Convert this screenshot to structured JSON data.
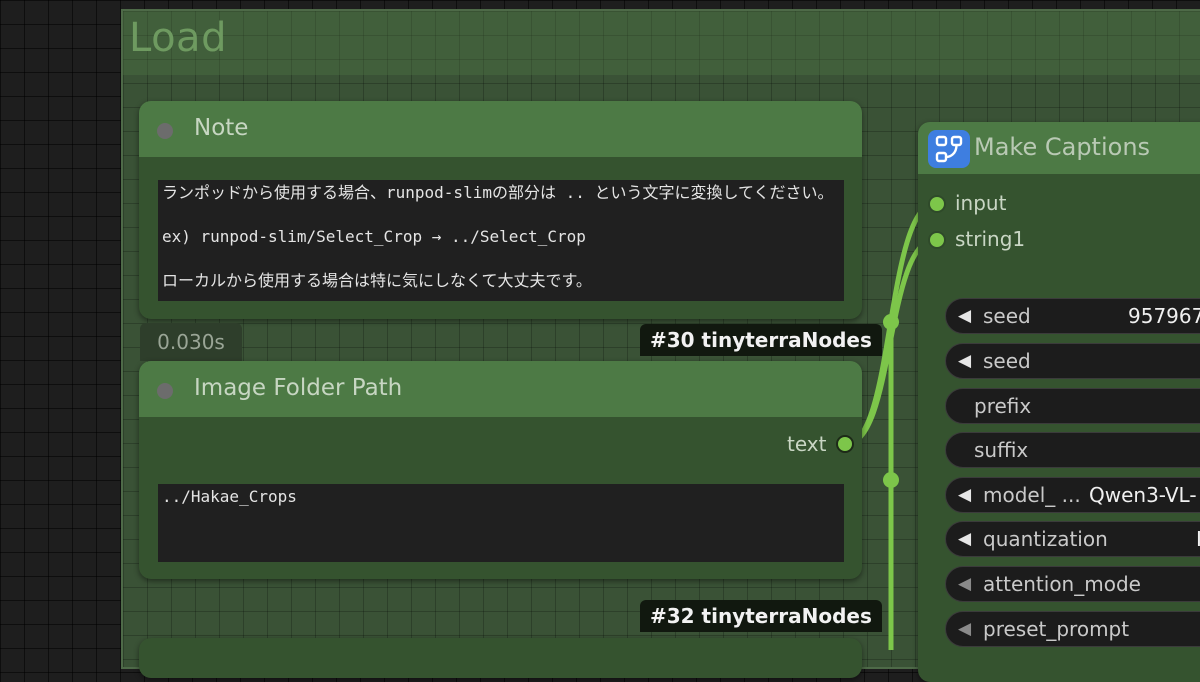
{
  "group": {
    "title": "Load"
  },
  "note_node": {
    "title": "Note",
    "text": "ランポッドから使用する場合、runpod-slimの部分は .. という文字に変換してください。\n\nex) runpod-slim/Select_Crop → ../Select_Crop\n\nローカルから使用する場合は特に気にしなくて大丈夫です。",
    "badge": "#30 tinyterraNodes"
  },
  "timing": "0.030s",
  "image_folder_node": {
    "title": "Image Folder Path",
    "output_label": "text",
    "value": "../Hakae_Crops",
    "badge": "#32 tinyterraNodes"
  },
  "make_captions_node": {
    "title": "Make Captions",
    "icon": "workflow-icon",
    "inputs": [
      "input",
      "string1"
    ],
    "widgets": [
      {
        "label": "seed",
        "value": "957967"
      },
      {
        "label": "seed",
        "value": ""
      },
      {
        "label": "prefix",
        "value": ""
      },
      {
        "label": "suffix",
        "value": ""
      },
      {
        "label": "model_ ...",
        "value": "Qwen3-VL-"
      },
      {
        "label": "quantization",
        "value": "I"
      },
      {
        "label": "attention_mode",
        "value": ""
      },
      {
        "label": "preset_prompt",
        "value": ""
      }
    ]
  },
  "colors": {
    "canvas": "#1e1e1e",
    "group": "#3a5236",
    "node_body": "#35532f",
    "node_header": "#4d7a45",
    "link": "#7dc64a",
    "icon_bg": "#3e7ee0"
  }
}
